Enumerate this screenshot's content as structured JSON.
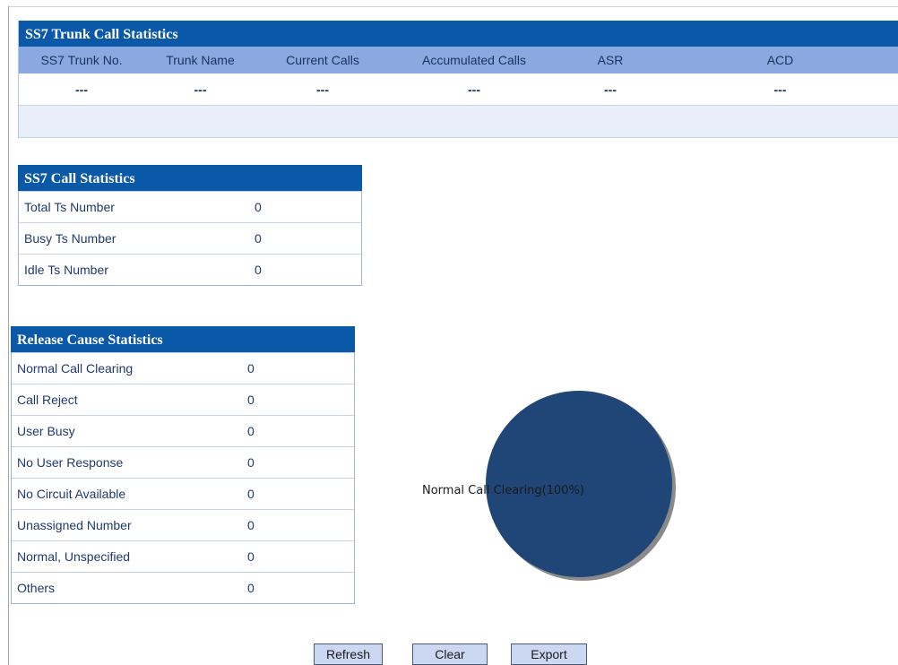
{
  "trunk_stats": {
    "title": "SS7 Trunk Call Statistics",
    "columns": [
      "SS7 Trunk No.",
      "Trunk Name",
      "Current Calls",
      "Accumulated Calls",
      "ASR",
      "ACD"
    ],
    "rows": [
      [
        "---",
        "---",
        "---",
        "---",
        "---",
        "---"
      ]
    ]
  },
  "ss7_stats": {
    "title": "SS7 Call Statistics",
    "items": [
      {
        "label": "Total Ts Number",
        "value": "0"
      },
      {
        "label": "Busy Ts Number",
        "value": "0"
      },
      {
        "label": "Idle Ts Number",
        "value": "0"
      }
    ]
  },
  "release_stats": {
    "title": "Release Cause Statistics",
    "items": [
      {
        "label": "Normal Call Clearing",
        "value": "0"
      },
      {
        "label": "Call Reject",
        "value": "0"
      },
      {
        "label": "User Busy",
        "value": "0"
      },
      {
        "label": "No User Response",
        "value": "0"
      },
      {
        "label": "No Circuit Available",
        "value": "0"
      },
      {
        "label": "Unassigned Number",
        "value": "0"
      },
      {
        "label": "Normal, Unspecified",
        "value": "0"
      },
      {
        "label": "Others",
        "value": "0"
      }
    ]
  },
  "chart_data": {
    "type": "pie",
    "categories": [
      "Normal Call Clearing"
    ],
    "values": [
      100
    ],
    "slice_label": "Normal Call Clearing(100%)",
    "colors": [
      "#1f4676"
    ]
  },
  "buttons": {
    "refresh": "Refresh",
    "clear": "Clear",
    "export": "Export"
  }
}
